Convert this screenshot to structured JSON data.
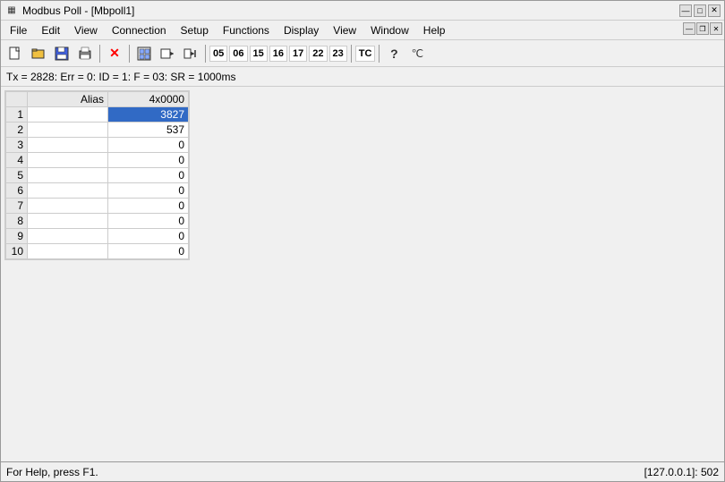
{
  "titleBar": {
    "appIcon": "▦",
    "title": "Modbus Poll - [Mbpoll1]",
    "minimizeBtn": "—",
    "maximizeBtn": "□",
    "closeBtn": "✕"
  },
  "menuBar": {
    "items": [
      "File",
      "Edit",
      "View",
      "Connection",
      "Setup",
      "Functions",
      "Display",
      "View",
      "Window",
      "Help"
    ]
  },
  "toolbar": {
    "buttons": [
      {
        "name": "new",
        "icon": "📄"
      },
      {
        "name": "open",
        "icon": "📂"
      },
      {
        "name": "save",
        "icon": "💾"
      },
      {
        "name": "print",
        "icon": "🖨"
      },
      {
        "name": "stop",
        "icon": "✕"
      },
      {
        "name": "window",
        "icon": "▣"
      },
      {
        "name": "read",
        "icon": "→"
      },
      {
        "name": "step",
        "icon": "⇒"
      }
    ],
    "labels": [
      "05",
      "06",
      "15",
      "16",
      "17",
      "22",
      "23"
    ],
    "tcLabel": "TC",
    "icons2": [
      "?",
      "℃"
    ]
  },
  "statusLine": {
    "text": "Tx = 2828: Err = 0: ID = 1: F = 03: SR = 1000ms"
  },
  "table": {
    "headers": [
      "",
      "Alias",
      "4x0000"
    ],
    "rows": [
      {
        "num": 1,
        "alias": "",
        "value": "3827",
        "selected": true
      },
      {
        "num": 2,
        "alias": "",
        "value": "537",
        "selected": false
      },
      {
        "num": 3,
        "alias": "",
        "value": "0",
        "selected": false
      },
      {
        "num": 4,
        "alias": "",
        "value": "0",
        "selected": false
      },
      {
        "num": 5,
        "alias": "",
        "value": "0",
        "selected": false
      },
      {
        "num": 6,
        "alias": "",
        "value": "0",
        "selected": false
      },
      {
        "num": 7,
        "alias": "",
        "value": "0",
        "selected": false
      },
      {
        "num": 8,
        "alias": "",
        "value": "0",
        "selected": false
      },
      {
        "num": 9,
        "alias": "",
        "value": "0",
        "selected": false
      },
      {
        "num": 10,
        "alias": "",
        "value": "0",
        "selected": false
      }
    ]
  },
  "bottomStatus": {
    "left": "For Help, press F1.",
    "right": "[127.0.0.1]: 502"
  },
  "mdi": {
    "minBtn": "—",
    "restoreBtn": "❐",
    "closeBtn": "✕"
  }
}
